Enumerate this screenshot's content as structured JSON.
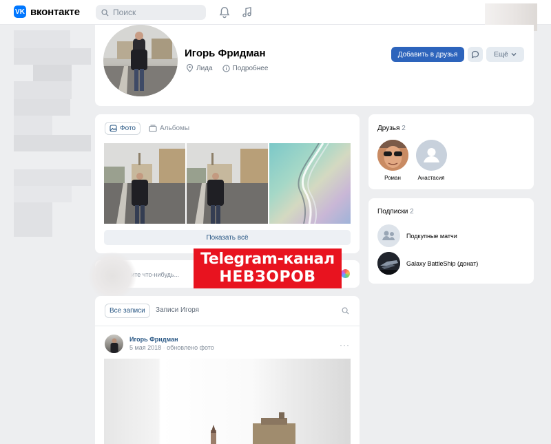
{
  "header": {
    "logo_text": "вконтакте",
    "logo_mark": "VK",
    "search_placeholder": "Поиск"
  },
  "profile": {
    "name": "Игорь Фридман",
    "city": "Лида",
    "details_label": "Подробнее",
    "add_friend_label": "Добавить в друзья",
    "more_label": "Ещё"
  },
  "photos": {
    "tab_photos": "Фото",
    "tab_albums": "Альбомы",
    "show_all": "Показать всё"
  },
  "composer": {
    "placeholder_visible": "шите что-нибудь..."
  },
  "banner": {
    "line1": "Telegram-канал",
    "line2": "НЕВЗОРОВ"
  },
  "wall": {
    "tab_all": "Все записи",
    "tab_user": "Записи Игоря",
    "post": {
      "author": "Игорь Фридман",
      "date": "5 мая 2018",
      "action": "обновлено фото",
      "more": "···"
    }
  },
  "friends": {
    "title": "Друзья",
    "count": "2",
    "items": [
      {
        "name": "Роман"
      },
      {
        "name": "Анастасия"
      }
    ]
  },
  "subscriptions": {
    "title": "Подписки",
    "count": "2",
    "items": [
      {
        "name": "Подкупные матчи"
      },
      {
        "name": "Galaxy BattleShip (донат)"
      }
    ]
  },
  "colors": {
    "accent": "#2d64bc",
    "link": "#2a5885",
    "banner": "#e8131f",
    "background": "#edeef0"
  }
}
